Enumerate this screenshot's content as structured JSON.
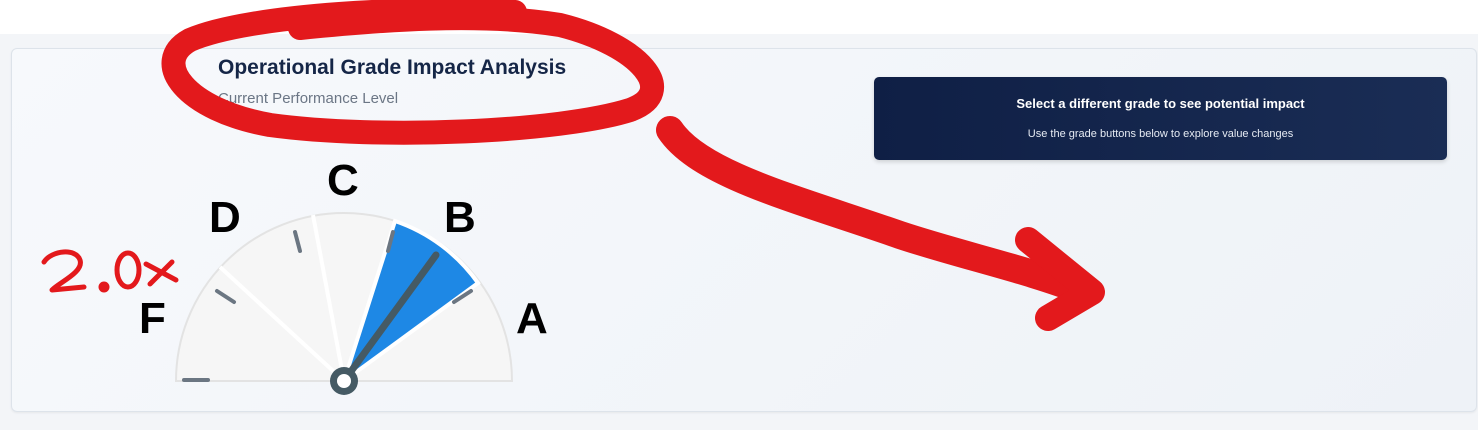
{
  "header": {
    "title": "Operational Grade Impact Analysis",
    "subtitle": "Current Performance Level"
  },
  "info_panel": {
    "heading": "Select a different grade to see potential impact",
    "subtext": "Use the grade buttons below to explore value changes"
  },
  "gauge": {
    "grades": [
      "F",
      "D",
      "C",
      "B",
      "A"
    ],
    "current_grade": "B",
    "highlight_color": "#1e88e5",
    "needle_color": "#455a64"
  },
  "annotation": {
    "handwritten_text": "2.0x",
    "ink_color": "#e3191c"
  }
}
